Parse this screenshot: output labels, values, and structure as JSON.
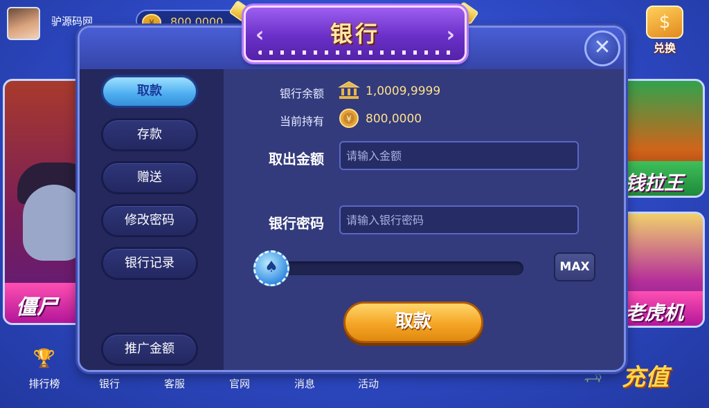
{
  "lobby": {
    "username": "驴源码网",
    "coin_balance": "800,0000",
    "exchange_label": "兑换",
    "game_cards": [
      "僵尸",
      "钱拉王",
      "老虎机"
    ],
    "nav": [
      {
        "label": "排行榜",
        "icon": "trophy-icon"
      },
      {
        "label": "银行",
        "icon": "bank-icon"
      },
      {
        "label": "客服",
        "icon": "headset-icon"
      },
      {
        "label": "官网",
        "icon": "globe-icon"
      },
      {
        "label": "消息",
        "icon": "mail-icon"
      },
      {
        "label": "活动",
        "icon": "gift-icon"
      }
    ],
    "recharge_label": "充值"
  },
  "bank_dialog": {
    "title": "银行",
    "sidebar": [
      {
        "label": "取款",
        "active": true
      },
      {
        "label": "存款",
        "active": false
      },
      {
        "label": "赠送",
        "active": false
      },
      {
        "label": "修改密码",
        "active": false
      },
      {
        "label": "银行记录",
        "active": false
      },
      {
        "label": "推广金额",
        "active": false
      }
    ],
    "bank_balance_label": "银行余额",
    "bank_balance_value": "1,0009,9999",
    "holding_label": "当前持有",
    "holding_value": "800,0000",
    "amount_label": "取出金额",
    "amount_placeholder": "请输入金额",
    "password_label": "银行密码",
    "password_placeholder": "请输入银行密码",
    "slider_fraction": 0.0,
    "max_label": "MAX",
    "submit_label": "取款"
  },
  "colors": {
    "accent_gold": "#ffd86a",
    "active_tab": "#4dadf0",
    "submit_button": "#f5a526"
  }
}
